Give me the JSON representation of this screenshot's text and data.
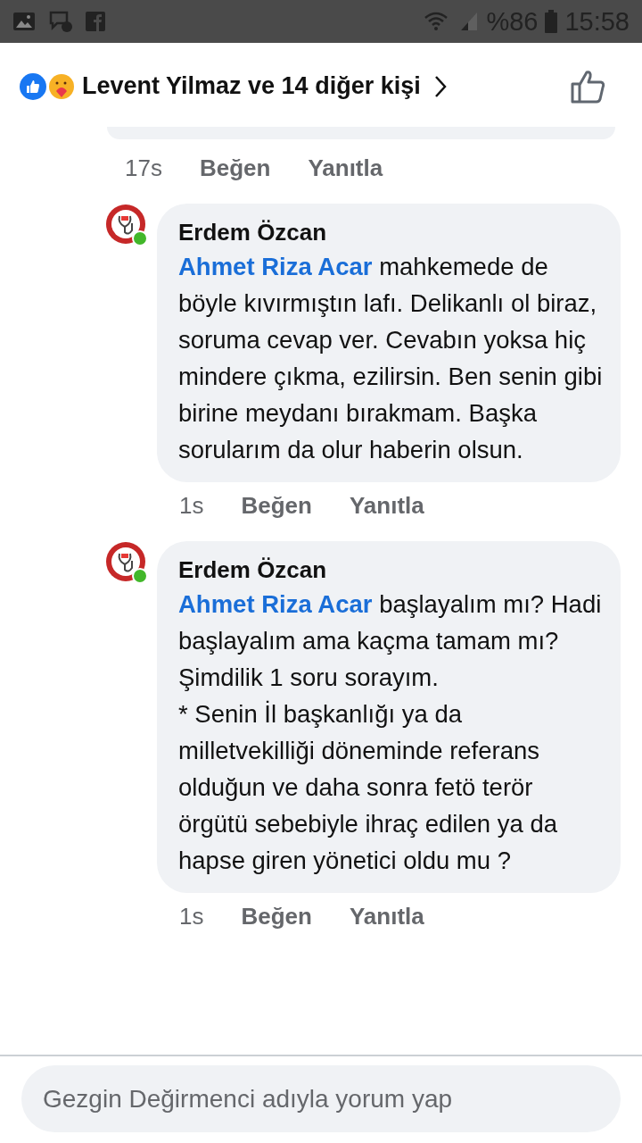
{
  "status_bar": {
    "battery": "%86",
    "time": "15:58"
  },
  "reactions": {
    "text": "Levent Yilmaz ve 14 diğer kişi"
  },
  "previous_comment": {
    "time": "17s",
    "like": "Beğen",
    "reply": "Yanıtla"
  },
  "comments": [
    {
      "author": "Erdem Özcan",
      "online": true,
      "mention": "Ahmet Riza Acar",
      "text": " mahkemede de böyle kıvırmıştın lafı. Delikanlı ol biraz, soruma cevap ver. Cevabın yoksa hiç mindere çıkma, ezilirsin. Ben senin gibi birine meydanı bırakmam. Başka sorularım da olur haberin olsun.",
      "time": "1s",
      "like": "Beğen",
      "reply": "Yanıtla"
    },
    {
      "author": "Erdem Özcan",
      "online": true,
      "mention": "Ahmet Riza Acar",
      "text": " başlayalım mı? Hadi başlayalım ama kaçma tamam mı? Şimdilik 1 soru sorayım.\n* Senin İl başkanlığı ya da milletvekilliği döneminde referans olduğun ve daha sonra fetö terör örgütü sebebiyle ihraç edilen ya da hapse giren yönetici oldu mu ?",
      "time": "1s",
      "like": "Beğen",
      "reply": "Yanıtla"
    }
  ],
  "composer": {
    "placeholder": "Gezgin Değirmenci adıyla yorum yap"
  }
}
